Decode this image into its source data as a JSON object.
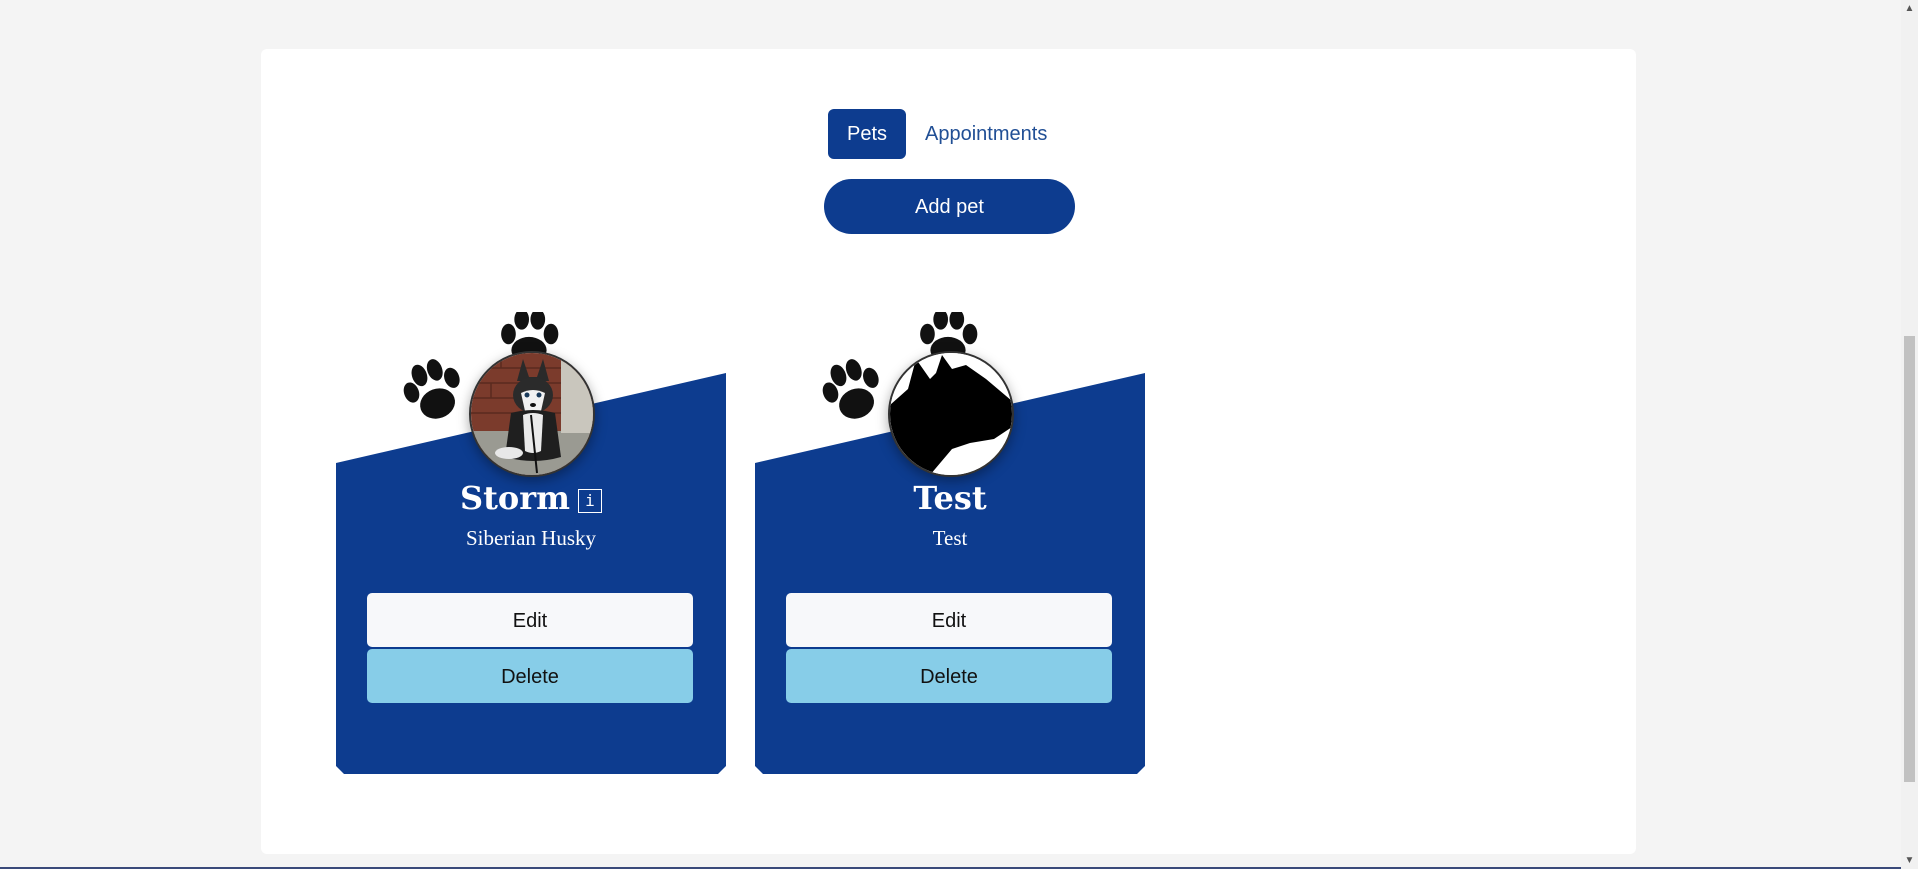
{
  "tabs": [
    {
      "label": "Pets",
      "active": true
    },
    {
      "label": "Appointments",
      "active": false
    }
  ],
  "actions": {
    "add_pet_label": "Add pet"
  },
  "pets": [
    {
      "name": "Storm",
      "info_label": "i",
      "breed": "Siberian Husky",
      "avatar": "husky-photo",
      "edit_label": "Edit",
      "delete_label": "Delete"
    },
    {
      "name": "Test",
      "breed": "Test",
      "avatar": "cat-silhouette",
      "edit_label": "Edit",
      "delete_label": "Delete"
    }
  ],
  "colors": {
    "primary": "#0d3c8f",
    "delete": "#87cde8",
    "edit": "#f7f8fa",
    "page_bg": "#f4f4f4"
  },
  "icons": [
    "paw-icon",
    "info-icon",
    "scroll-up-arrow-icon",
    "scroll-down-arrow-icon"
  ]
}
